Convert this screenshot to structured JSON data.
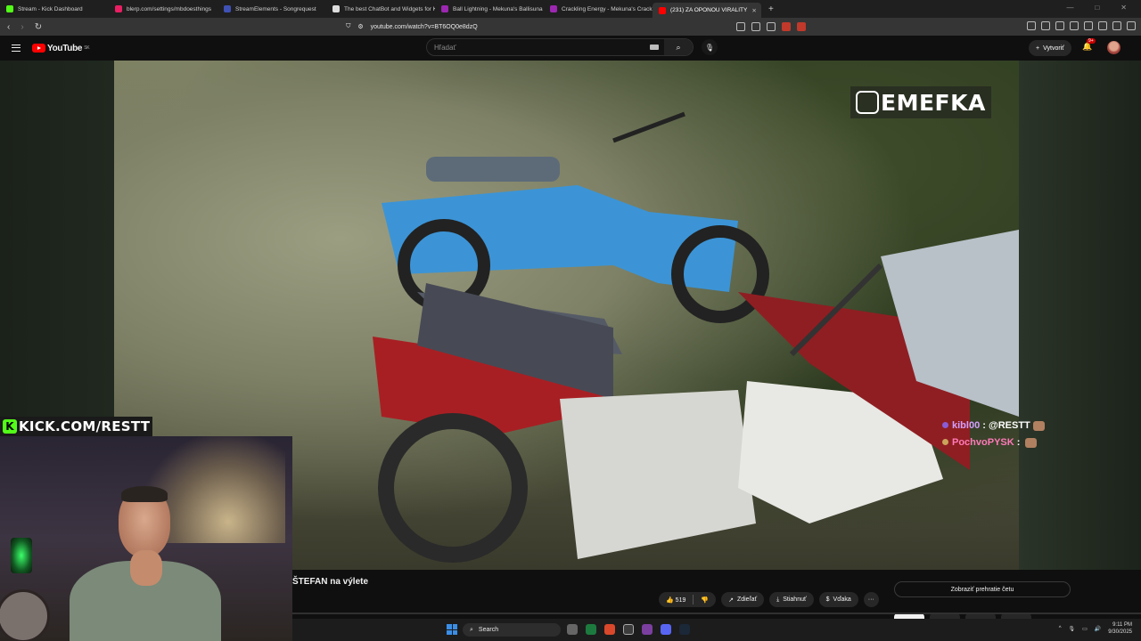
{
  "tabs": [
    {
      "title": "Stream - Kick Dashboard",
      "color": "#53fc18"
    },
    {
      "title": "blerp.com/settings/mbdoesthings",
      "color": "#e91e63"
    },
    {
      "title": "StreamElements - Songrequest",
      "color": "#3f51b5"
    },
    {
      "title": "The best ChatBot and Widgets for K",
      "color": "#dddddd"
    },
    {
      "title": "Ball Lightning - Mekuna's Ballisuna",
      "color": "#9c27b0"
    },
    {
      "title": "Crackling Energy - Mekuna's Crackli",
      "color": "#9c27b0"
    },
    {
      "title": "(231) ZA OPONOU VIRALITY",
      "color": "#ff0000",
      "active": true
    }
  ],
  "address": {
    "url": "youtube.com/watch?v=BT6OQ0e8dzQ"
  },
  "youtube": {
    "logo": "YouTube",
    "region": "SK",
    "search_placeholder": "Hľadať",
    "create_label": "Vytvoriť",
    "notifications": "9+"
  },
  "overlay": {
    "channel_watermark": "EMEFKA",
    "kick_url": "KICK.COM/RESTT",
    "chat": [
      {
        "user": "kibl00",
        "message": "@RESTT"
      },
      {
        "user": "PochvoPYSK",
        "message": ""
      }
    ]
  },
  "video": {
    "title": "ŠTEFAN na výlete",
    "likes": "519",
    "share_label": "Zdieľať",
    "download_label": "Stiahnuť",
    "thanks_label": "Vďaka",
    "more_label": "···",
    "show_chat_label": "Zobraziť prehratie četu"
  },
  "taskbar": {
    "search_label": "Search",
    "time": "9:11 PM",
    "date": "9/30/2025"
  }
}
